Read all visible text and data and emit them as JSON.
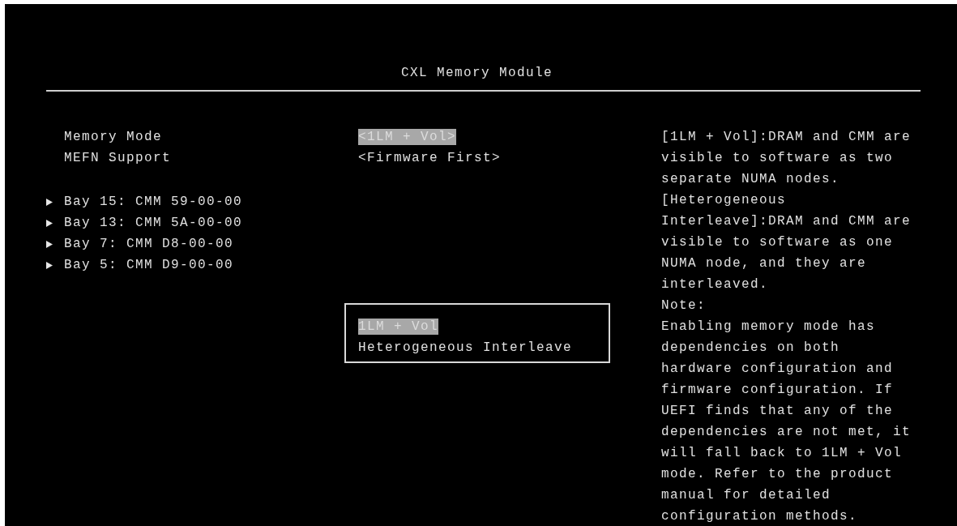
{
  "title": "CXL Memory Module",
  "settings": [
    {
      "label": "Memory Mode",
      "value": "<1LM + Vol>",
      "selected": true
    },
    {
      "label": "MEFN Support",
      "value": "<Firmware First>",
      "selected": false
    }
  ],
  "submenus": [
    {
      "label": "Bay 15: CMM 59-00-00"
    },
    {
      "label": "Bay 13: CMM 5A-00-00"
    },
    {
      "label": "Bay 7: CMM D8-00-00"
    },
    {
      "label": "Bay 5: CMM D9-00-00"
    }
  ],
  "popup": {
    "options": [
      {
        "label": "1LM + Vol",
        "selected": true
      },
      {
        "label": "Heterogeneous Interleave",
        "selected": false
      }
    ]
  },
  "help": [
    "[1LM + Vol]:DRAM and CMM are",
    "visible to software as two",
    "separate NUMA nodes.",
    "[Heterogeneous",
    "Interleave]:DRAM and CMM are",
    "visible to software as one",
    "NUMA node, and they are",
    "interleaved.",
    "Note:",
    "Enabling memory mode has",
    "dependencies on both",
    "hardware configuration and",
    "firmware configuration. If",
    "UEFI finds that any of the",
    "dependencies are not met, it",
    "will fall back to 1LM + Vol",
    "mode. Refer to the product",
    "manual for detailed",
    "configuration methods."
  ]
}
